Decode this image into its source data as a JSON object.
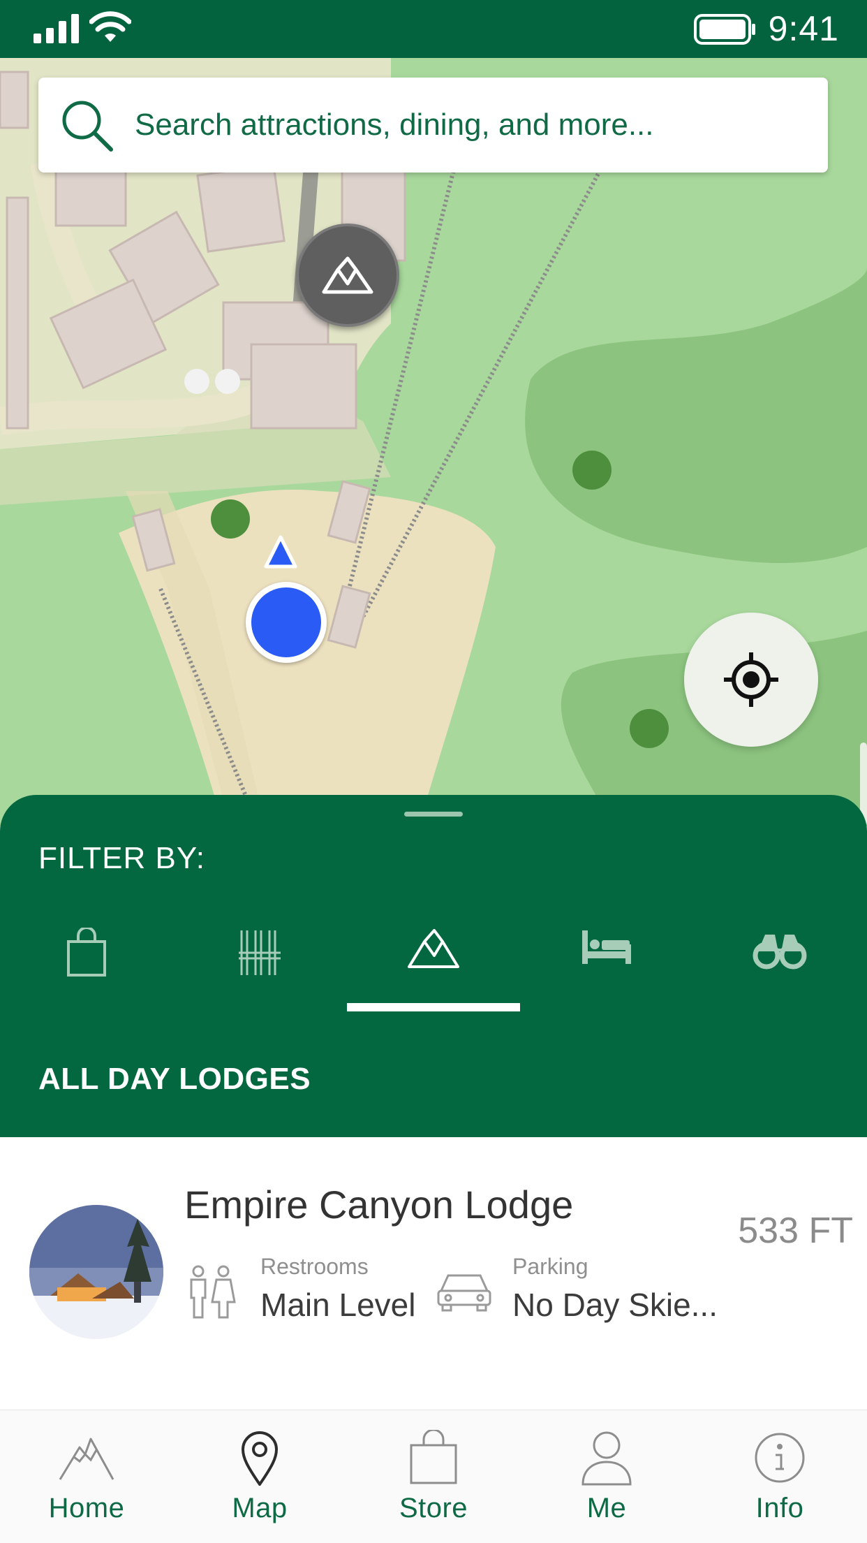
{
  "status_bar": {
    "time": "9:41"
  },
  "search": {
    "placeholder": "Search attractions, dining, and more..."
  },
  "sheet": {
    "filter_label": "FILTER BY:",
    "filters": [
      {
        "icon": "shopping-bag-icon"
      },
      {
        "icon": "ski-rental-icon"
      },
      {
        "icon": "lodge-icon",
        "active": true
      },
      {
        "icon": "bed-icon"
      },
      {
        "icon": "binoculars-icon"
      }
    ],
    "section_title": "ALL DAY LODGES"
  },
  "list": {
    "items": [
      {
        "name": "Empire Canyon Lodge",
        "distance": "533 FT",
        "restrooms_label": "Restrooms",
        "restrooms_value": "Main Level",
        "parking_label": "Parking",
        "parking_value": "No Day Skie..."
      }
    ]
  },
  "nav": {
    "items": [
      {
        "label": "Home",
        "icon": "mountain-icon"
      },
      {
        "label": "Map",
        "icon": "map-pin-icon"
      },
      {
        "label": "Store",
        "icon": "shopping-bag-icon"
      },
      {
        "label": "Me",
        "icon": "person-icon"
      },
      {
        "label": "Info",
        "icon": "info-icon"
      }
    ]
  },
  "colors": {
    "brand_green": "#03683f",
    "map_green": "#a6d69a",
    "user_location": "#2a5cf5"
  }
}
